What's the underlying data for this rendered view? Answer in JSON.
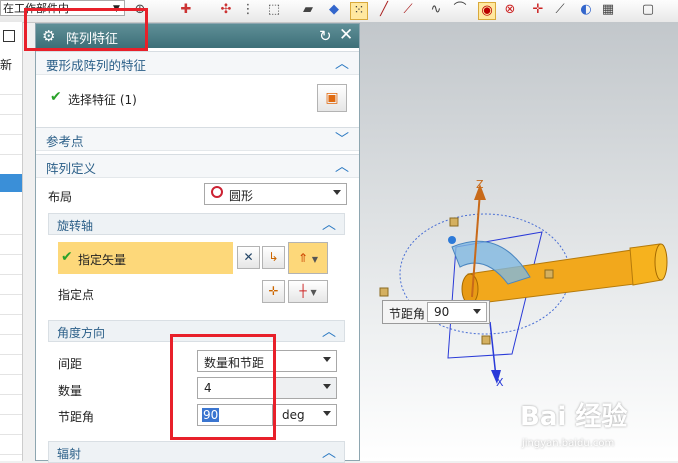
{
  "toolbar": {
    "filter_label": "在工作部件内"
  },
  "left_strip": {
    "new_label": "新"
  },
  "dialog": {
    "title": "阵列特征",
    "sections": {
      "feature_to_pattern": {
        "label": "要形成阵列的特征",
        "select_feature_label": "选择特征 (1)"
      },
      "reference_point": {
        "label": "参考点"
      },
      "pattern_definition": {
        "label": "阵列定义",
        "layout_label": "布局",
        "layout_value": "圆形",
        "rotation_axis": {
          "label": "旋转轴",
          "specify_vector_label": "指定矢量",
          "specify_point_label": "指定点"
        },
        "angular_direction": {
          "label": "角度方向",
          "spacing_label": "间距",
          "spacing_value": "数量和节距",
          "count_label": "数量",
          "count_value": "4",
          "pitch_label": "节距角",
          "pitch_value": "90",
          "pitch_unit": "deg"
        },
        "radiate": {
          "label": "辐射"
        }
      }
    }
  },
  "graphics": {
    "pitch_float_label": "节距角",
    "pitch_float_value": "90",
    "axis_z": "Z",
    "axis_x": "X",
    "watermark": "Bai 经验",
    "watermark_sub": "jingyan.baidu.com"
  },
  "colors": {
    "title_bar": "#4a7c85",
    "section_label": "#2b5f88",
    "highlight_row": "#fdd87a",
    "red_box": "#e8202a",
    "part_color": "#f2a81c"
  }
}
